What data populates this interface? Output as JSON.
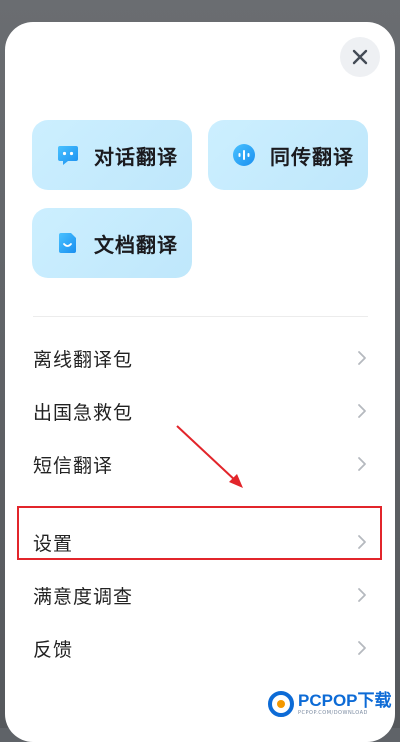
{
  "sheet": {
    "close_icon": "close-icon"
  },
  "tiles": [
    {
      "label": "对话翻译",
      "icon": "chat-bubble-icon"
    },
    {
      "label": "同传翻译",
      "icon": "voice-wave-icon"
    },
    {
      "label": "文档翻译",
      "icon": "document-icon"
    }
  ],
  "menu": {
    "items": [
      {
        "label": "离线翻译包"
      },
      {
        "label": "出国急救包"
      },
      {
        "label": "短信翻译"
      },
      {
        "label": "设置"
      },
      {
        "label": "满意度调查"
      },
      {
        "label": "反馈"
      }
    ]
  },
  "watermark": {
    "brand": "PCPOP下载",
    "sub": "PCPOP.COM/DOWNLOAD"
  },
  "colors": {
    "accent": "#1fa3ef",
    "tile_bg": "#ccefff",
    "annotation_red": "#e2252b"
  }
}
